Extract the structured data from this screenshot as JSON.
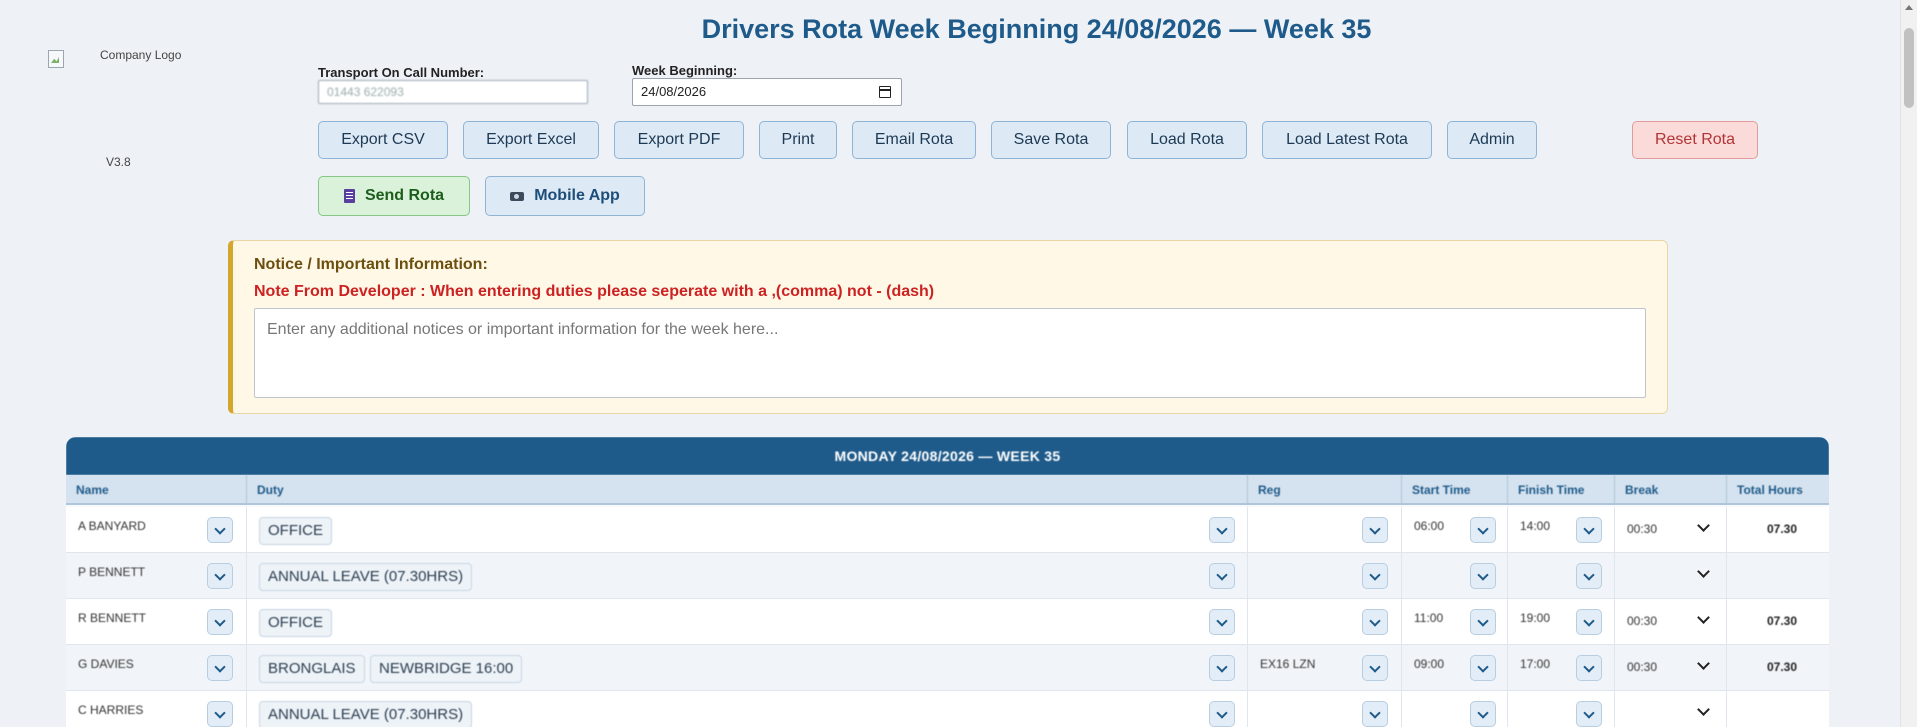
{
  "header": {
    "title": "Drivers Rota Week Beginning 24/08/2026 — Week 35",
    "logo_alt": "Company Logo",
    "version": "V3.8"
  },
  "on_call": {
    "label": "Transport On Call Number:",
    "value": "01443 622093"
  },
  "week": {
    "label": "Week Beginning:",
    "value": "24/08/2026"
  },
  "toolbar": {
    "export_csv": "Export CSV",
    "export_excel": "Export Excel",
    "export_pdf": "Export PDF",
    "print": "Print",
    "email_rota": "Email Rota",
    "save_rota": "Save Rota",
    "load_rota": "Load Rota",
    "load_latest": "Load Latest Rota",
    "admin": "Admin",
    "reset_rota": "Reset Rota",
    "send_rota": "Send Rota",
    "mobile_app": "Mobile App"
  },
  "notice": {
    "title": "Notice / Important Information:",
    "developer_note": "Note From Developer : When entering duties please seperate with a ,(comma) not - (dash)",
    "placeholder": "Enter any additional notices or important information for the week here..."
  },
  "day": {
    "header": "MONDAY 24/08/2026 — WEEK 35",
    "columns": {
      "name": "Name",
      "duty": "Duty",
      "reg": "Reg",
      "start": "Start Time",
      "finish": "Finish Time",
      "break": "Break",
      "total": "Total Hours"
    },
    "rows": [
      {
        "name": "A BANYARD",
        "duties": [
          "OFFICE"
        ],
        "reg": "",
        "start": "06:00",
        "finish": "14:00",
        "break": "00:30",
        "total": "07.30"
      },
      {
        "name": "P BENNETT",
        "duties": [
          "ANNUAL LEAVE (07.30HRS)"
        ],
        "reg": "",
        "start": "",
        "finish": "",
        "break": "",
        "total": ""
      },
      {
        "name": "R BENNETT",
        "duties": [
          "OFFICE"
        ],
        "reg": "",
        "start": "11:00",
        "finish": "19:00",
        "break": "00:30",
        "total": "07.30"
      },
      {
        "name": "G DAVIES",
        "duties": [
          "BRONGLAIS",
          "NEWBRIDGE 16:00"
        ],
        "reg": "EX16 LZN",
        "start": "09:00",
        "finish": "17:00",
        "break": "00:30",
        "total": "07.30"
      },
      {
        "name": "C HARRIES",
        "duties": [
          "ANNUAL LEAVE (07.30HRS)"
        ],
        "reg": "",
        "start": "",
        "finish": "",
        "break": "",
        "total": ""
      }
    ]
  },
  "colors": {
    "primary": "#1f5b8a",
    "notice_border": "#d4a72c",
    "dev_note": "#cc2222",
    "reset": "#b23434",
    "send": "#1d5e1d"
  },
  "icons": {
    "send_rota": "clipboard-icon",
    "mobile_app": "camera-icon"
  }
}
